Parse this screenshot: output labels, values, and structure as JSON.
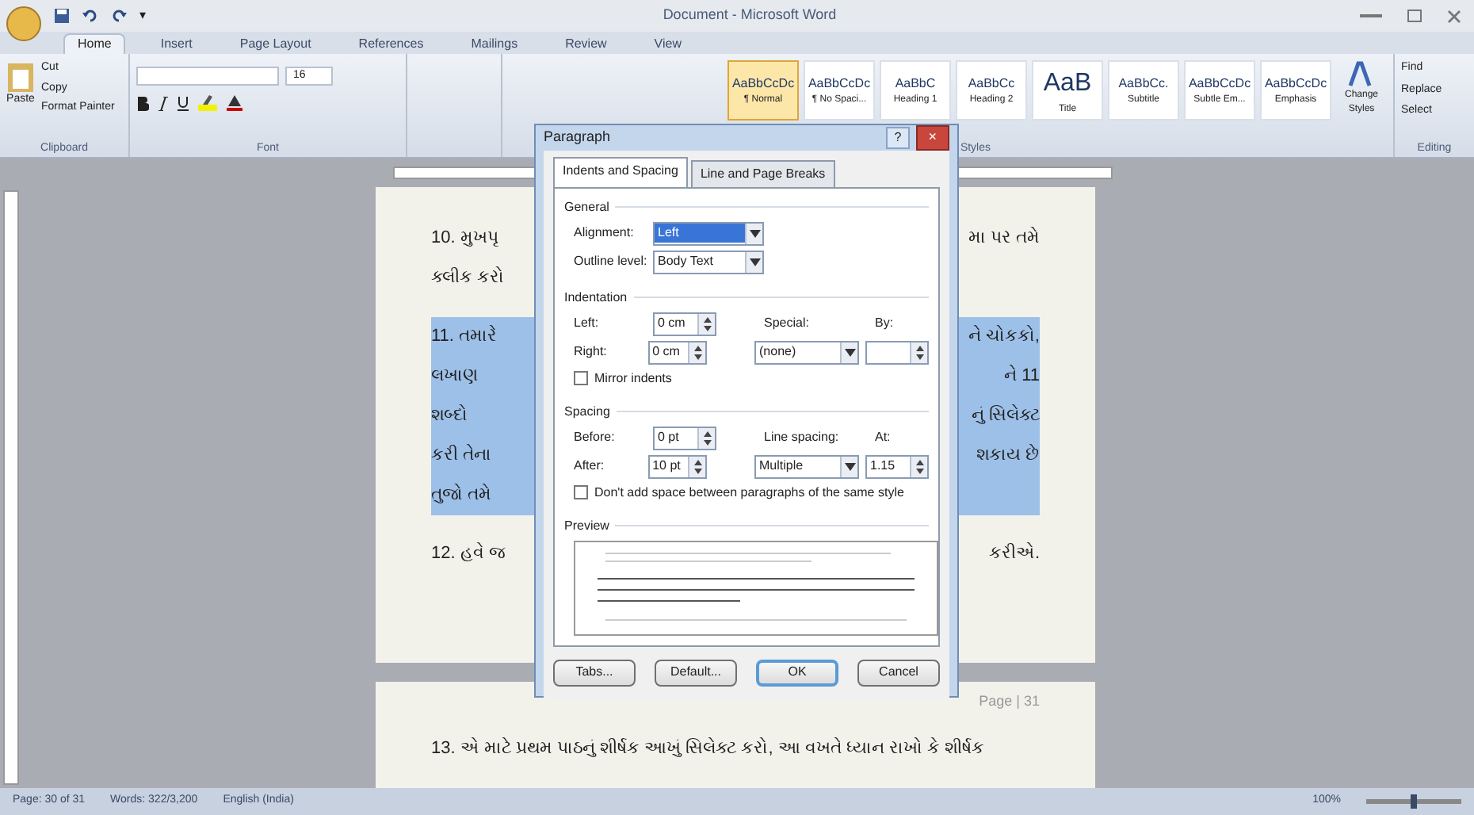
{
  "window": {
    "title": "Document - Microsoft Word"
  },
  "quick_access": [
    "▾"
  ],
  "ribbon_tabs": [
    {
      "label": "Home",
      "selected": true
    },
    {
      "label": "Insert",
      "selected": false
    },
    {
      "label": "Page Layout",
      "selected": false
    },
    {
      "label": "References",
      "selected": false
    },
    {
      "label": "Mailings",
      "selected": false
    },
    {
      "label": "Review",
      "selected": false
    },
    {
      "label": "View",
      "selected": false
    }
  ],
  "clipboard": {
    "paste": "Paste",
    "items": [
      "Cut",
      "Copy",
      "Format Painter"
    ],
    "label": "Clipboard"
  },
  "font": {
    "size": "16",
    "label": "Font"
  },
  "styles": {
    "items": [
      {
        "sample": "AaBbCcDc",
        "name": "¶ Normal",
        "selected": true
      },
      {
        "sample": "AaBbCcDc",
        "name": "¶ No Spaci...",
        "selected": false
      },
      {
        "sample": "AaBbC",
        "name": "Heading 1",
        "selected": false
      },
      {
        "sample": "AaBbCc",
        "name": "Heading 2",
        "selected": false
      },
      {
        "sample": "AaB",
        "name": "Title",
        "selected": false
      },
      {
        "sample": "AaBbCc.",
        "name": "Subtitle",
        "selected": false
      },
      {
        "sample": "AaBbCcDc",
        "name": "Subtle Em...",
        "selected": false
      },
      {
        "sample": "AaBbCcDc",
        "name": "Emphasis",
        "selected": false
      }
    ],
    "change": "Change Styles",
    "label": "Styles"
  },
  "editing": {
    "items": [
      "Find",
      "Replace",
      "Select"
    ],
    "label": "Editing"
  },
  "document": {
    "lines": [
      {
        "left": "10. મુખપૃ",
        "right": "મા પર તમે",
        "selected": false
      },
      {
        "left": "ક્લીક કરો",
        "selected": false
      },
      {
        "left": "11. તમારે",
        "right": "ને ચોકકો,",
        "selected": true
      },
      {
        "left": "લખાણ",
        "right": "ને 11",
        "selected": true
      },
      {
        "left": "શબ્દો",
        "right": "નું સિલેક્ટ",
        "selected": true
      },
      {
        "left": "કરી તેના",
        "right": "શકાય છે",
        "selected": true
      },
      {
        "left": "તુજો તમે",
        "selected": true
      },
      {
        "left": "12. હવે જ",
        "right": "કરીએ.",
        "selected": false
      }
    ],
    "page_footer": "Page | 31",
    "next_page_line": "13. એ માટે પ્રથમ પાઠનું શીર્ષક આખું સિલેક્ટ કરો, આ વખતે ધ્યાન રાખો કે શીર્ષક"
  },
  "dialog": {
    "title": "Paragraph",
    "help": "?",
    "close": "×",
    "tabs": [
      {
        "label": "Indents and Spacing",
        "selected": true
      },
      {
        "label": "Line and Page Breaks",
        "selected": false
      }
    ],
    "general": {
      "heading": "General",
      "alignment_label": "Alignment:",
      "alignment": "Left",
      "outline_label": "Outline level:",
      "outline": "Body Text"
    },
    "indentation": {
      "heading": "Indentation",
      "left_label": "Left:",
      "left": "0 cm",
      "right_label": "Right:",
      "right": "0 cm",
      "special_label": "Special:",
      "special": "(none)",
      "by_label": "By:",
      "mirror": {
        "label": "Mirror indents",
        "checked": false
      }
    },
    "spacing": {
      "heading": "Spacing",
      "before_label": "Before:",
      "before": "0 pt",
      "after_label": "After:",
      "after": "10 pt",
      "line_label": "Line spacing:",
      "line": "Multiple",
      "at_label": "At:",
      "at": "1.15",
      "dont_add": {
        "label": "Don't add space between paragraphs of the same style",
        "checked": false
      }
    },
    "preview": {
      "heading": "Preview"
    },
    "buttons": [
      {
        "label": "Tabs...",
        "default": false
      },
      {
        "label": "Default...",
        "default": false
      },
      {
        "label": "OK",
        "default": true
      },
      {
        "label": "Cancel",
        "default": false
      }
    ]
  },
  "status_bar": {
    "page": "Page: 30 of 31",
    "words": "Words: 322/3,200",
    "language": "English (India)",
    "zoom": "100%",
    "zoom_slider": {
      "level": 0.5
    }
  }
}
